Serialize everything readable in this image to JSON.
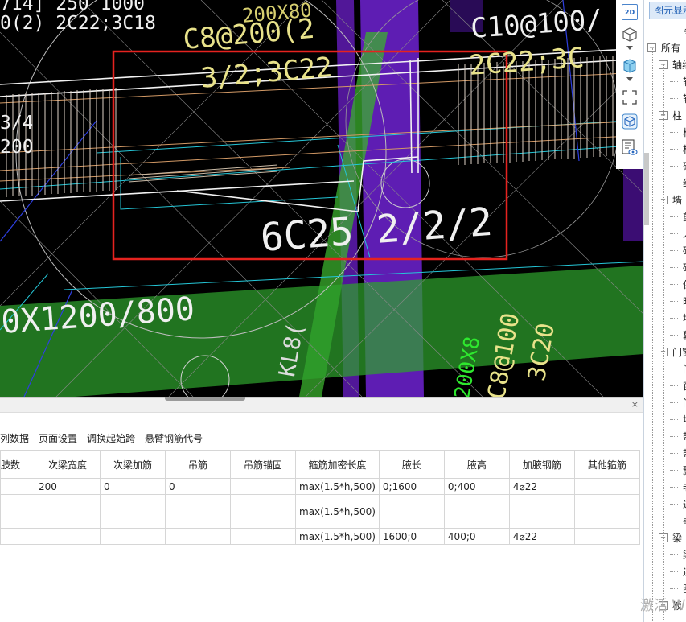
{
  "cad": {
    "texts": {
      "t1": "714] 250  1000",
      "t2": "0(2) 2C22;3C18",
      "t3": "C8@200(2",
      "t4": "3/2;3C22",
      "t5": "3/4",
      "t6": "200",
      "t7": "6C25 2/2/2",
      "t8": "0X1200/800",
      "t9": "C10@100/",
      "t10": "2C22;3C",
      "t11": "KL8(",
      "t12": "200X8",
      "t13": "C8@100",
      "t14": "3C20",
      "t15": "200X80"
    }
  },
  "vtoolbar": {
    "btn_2d": "2D",
    "icons": [
      "2d-view-icon",
      "3d-view-icon",
      "dropdown-icon",
      "cube-icon",
      "dropdown-icon",
      "fullscreen-icon",
      "component-view-icon",
      "display-settings-icon"
    ]
  },
  "right_panel": {
    "tab_label": "图元显示",
    "tree": [
      {
        "label": "图",
        "level": 2,
        "toggle": ""
      },
      {
        "label": "所有",
        "level": 0,
        "toggle": "−"
      },
      {
        "label": "轴线",
        "level": 1,
        "toggle": "−"
      },
      {
        "label": "轴",
        "level": 2,
        "toggle": ""
      },
      {
        "label": "轴",
        "level": 2,
        "toggle": ""
      },
      {
        "label": "柱",
        "level": 1,
        "toggle": "−"
      },
      {
        "label": "柱",
        "level": 2,
        "toggle": ""
      },
      {
        "label": "构",
        "level": 2,
        "toggle": ""
      },
      {
        "label": "砼",
        "level": 2,
        "toggle": ""
      },
      {
        "label": "约",
        "level": 2,
        "toggle": ""
      },
      {
        "label": "墙",
        "level": 1,
        "toggle": "−"
      },
      {
        "label": "剪",
        "level": 2,
        "toggle": ""
      },
      {
        "label": "人",
        "level": 2,
        "toggle": ""
      },
      {
        "label": "砌",
        "level": 2,
        "toggle": ""
      },
      {
        "label": "砌",
        "level": 2,
        "toggle": ""
      },
      {
        "label": "保",
        "level": 2,
        "toggle": ""
      },
      {
        "label": "暗",
        "level": 2,
        "toggle": ""
      },
      {
        "label": "墙",
        "level": 2,
        "toggle": ""
      },
      {
        "label": "幕",
        "level": 2,
        "toggle": ""
      },
      {
        "label": "门窗",
        "level": 1,
        "toggle": "−"
      },
      {
        "label": "门",
        "level": 2,
        "toggle": ""
      },
      {
        "label": "窗",
        "level": 2,
        "toggle": ""
      },
      {
        "label": "门",
        "level": 2,
        "toggle": ""
      },
      {
        "label": "墙",
        "level": 2,
        "toggle": ""
      },
      {
        "label": "带",
        "level": 2,
        "toggle": ""
      },
      {
        "label": "带",
        "level": 2,
        "toggle": ""
      },
      {
        "label": "飘",
        "level": 2,
        "toggle": ""
      },
      {
        "label": "老",
        "level": 2,
        "toggle": ""
      },
      {
        "label": "过",
        "level": 2,
        "toggle": ""
      },
      {
        "label": "壁",
        "level": 2,
        "toggle": ""
      },
      {
        "label": "梁",
        "level": 1,
        "toggle": "−"
      },
      {
        "label": "梁",
        "level": 2,
        "toggle": ""
      },
      {
        "label": "连",
        "level": 2,
        "toggle": ""
      },
      {
        "label": "圈",
        "level": 2,
        "toggle": ""
      },
      {
        "label": "板",
        "level": 1,
        "toggle": "−"
      }
    ]
  },
  "bottom_panel": {
    "close_label": "×",
    "toolbar": [
      "跨列数据",
      "页面设置",
      "调换起始跨",
      "悬臂钢筋代号"
    ],
    "columns": [
      "肢数",
      "次梁宽度",
      "次梁加筋",
      "吊筋",
      "吊筋锚固",
      "箍筋加密长度",
      "腋长",
      "腋高",
      "加腋钢筋",
      "其他箍筋"
    ],
    "rows": [
      [
        "",
        "200",
        "0",
        "0",
        "",
        "max(1.5*h,500)",
        "0;1600",
        "0;400",
        "4⌀22",
        ""
      ],
      [
        "",
        "",
        "",
        "",
        "",
        "max(1.5*h,500)",
        "",
        "",
        "",
        ""
      ],
      [
        "",
        "",
        "",
        "",
        "",
        "max(1.5*h,500)",
        "1600;0",
        "400;0",
        "4⌀22",
        ""
      ]
    ]
  },
  "watermark": "激活 W"
}
